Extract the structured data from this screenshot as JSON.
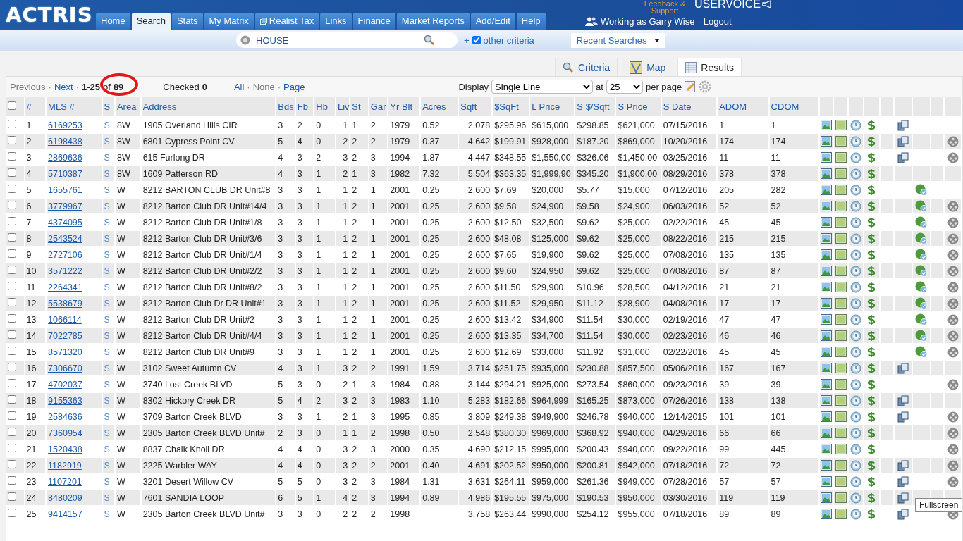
{
  "header": {
    "logo": "ACTRIS",
    "nav": [
      {
        "label": "Home",
        "selected": false
      },
      {
        "label": "Search",
        "selected": true
      },
      {
        "label": "Stats",
        "selected": false
      },
      {
        "label": "My Matrix",
        "selected": false
      },
      {
        "label": "Realist Tax",
        "selected": false
      },
      {
        "label": "Links",
        "selected": false
      },
      {
        "label": "Finance",
        "selected": false
      },
      {
        "label": "Market Reports",
        "selected": false
      },
      {
        "label": "Add/Edit",
        "selected": false
      },
      {
        "label": "Help",
        "selected": false
      }
    ],
    "feedback": "Feedback & Support",
    "uservoice": "USERVOICE",
    "user": "Working as Garry Wise",
    "separator": "·",
    "logout": "Logout"
  },
  "search_bar": {
    "query": "HOUSE",
    "plus": "+",
    "other_criteria": {
      "label": "other criteria",
      "checked": true
    },
    "recent": "Recent Searches"
  },
  "view_tabs": [
    {
      "label": "Criteria",
      "selected": false
    },
    {
      "label": "Map",
      "selected": false
    },
    {
      "label": "Results",
      "selected": true
    }
  ],
  "pager": {
    "separators": [
      "·",
      "·",
      "·",
      "·"
    ],
    "previous": {
      "label": "Previous",
      "disabled": true
    },
    "next": "Next",
    "range": "1-25",
    "of": "of",
    "total": "89",
    "checked_label": "Checked",
    "checked_count": "0",
    "all": "All",
    "none": {
      "label": "None",
      "disabled": true
    },
    "page": "Page",
    "display_label": "Display",
    "display_value": "Single Line",
    "at": "at",
    "per_page_value": "25",
    "per_page": "per page"
  },
  "table": {
    "select_all_checked": false,
    "columns": [
      "#",
      "MLS #",
      "S",
      "Area",
      "Address",
      "Bds",
      "Fb",
      "Hb",
      "Liv",
      "St",
      "Gar",
      "Yr Blt",
      "Acres",
      "Sqft",
      "$SqFt",
      "L Price",
      "S $/Sqft",
      "S Price",
      "S Date",
      "ADOM",
      "CDOM"
    ],
    "rows": [
      {
        "checked": false,
        "flyer": true,
        "price_change": false,
        "reel": false,
        "cells": [
          "1",
          "6169253",
          "S",
          "8W",
          "1905 Overland Hills CIR",
          "3",
          "2",
          "0",
          "1",
          "1",
          "2",
          "1979",
          "0.52",
          "2,078",
          "$295.96",
          "$615,000",
          "$298.85",
          "$621,000",
          "07/15/2016",
          "1",
          "1"
        ]
      },
      {
        "checked": false,
        "flyer": true,
        "price_change": false,
        "reel": true,
        "cells": [
          "2",
          "6198438",
          "S",
          "8W",
          "6801 Cypress Point CV",
          "5",
          "4",
          "0",
          "2",
          "2",
          "2",
          "1979",
          "0.37",
          "4,642",
          "$199.91",
          "$928,000",
          "$187.20",
          "$869,000",
          "10/20/2016",
          "174",
          "174"
        ]
      },
      {
        "checked": false,
        "flyer": true,
        "price_change": false,
        "reel": true,
        "cells": [
          "3",
          "2869636",
          "S",
          "8W",
          "615 Furlong DR",
          "4",
          "3",
          "2",
          "3",
          "2",
          "3",
          "1994",
          "1.87",
          "4,447",
          "$348.55",
          "$1,550,00",
          "$326.06",
          "$1,450,00",
          "03/25/2016",
          "11",
          "11"
        ]
      },
      {
        "checked": false,
        "flyer": false,
        "price_change": false,
        "reel": false,
        "cells": [
          "4",
          "5710387",
          "S",
          "8W",
          "1609 Patterson RD",
          "4",
          "3",
          "1",
          "2",
          "1",
          "3",
          "1982",
          "7.32",
          "5,504",
          "$363.35",
          "$1,999,90",
          "$345.20",
          "$1,900,00",
          "08/29/2016",
          "378",
          "378"
        ]
      },
      {
        "checked": false,
        "flyer": false,
        "price_change": true,
        "reel": false,
        "cells": [
          "5",
          "1655761",
          "S",
          "W",
          "8212 BARTON CLUB DR Unit#8",
          "3",
          "3",
          "1",
          "1",
          "2",
          "1",
          "2001",
          "0.25",
          "2,600",
          "$7.69",
          "$20,000",
          "$5.77",
          "$15,000",
          "07/12/2016",
          "205",
          "282"
        ]
      },
      {
        "checked": false,
        "flyer": false,
        "price_change": true,
        "reel": true,
        "cells": [
          "6",
          "3779967",
          "S",
          "W",
          "8212 Barton Club DR Unit#14/4",
          "3",
          "3",
          "1",
          "1",
          "2",
          "1",
          "2001",
          "0.25",
          "2,600",
          "$9.58",
          "$24,900",
          "$9.58",
          "$24,900",
          "06/03/2016",
          "52",
          "52"
        ]
      },
      {
        "checked": false,
        "flyer": false,
        "price_change": true,
        "reel": true,
        "cells": [
          "7",
          "4374095",
          "S",
          "W",
          "8212 Barton Club DR Unit#1/8",
          "3",
          "3",
          "1",
          "1",
          "2",
          "1",
          "2001",
          "0.25",
          "2,600",
          "$12.50",
          "$32,500",
          "$9.62",
          "$25,000",
          "02/22/2016",
          "45",
          "45"
        ]
      },
      {
        "checked": false,
        "flyer": false,
        "price_change": true,
        "reel": true,
        "cells": [
          "8",
          "2543524",
          "S",
          "W",
          "8212 Barton Club DR Unit#3/6",
          "3",
          "3",
          "1",
          "1",
          "2",
          "1",
          "2001",
          "0.25",
          "2,600",
          "$48.08",
          "$125,000",
          "$9.62",
          "$25,000",
          "08/22/2016",
          "215",
          "215"
        ]
      },
      {
        "checked": false,
        "flyer": false,
        "price_change": true,
        "reel": true,
        "cells": [
          "9",
          "2727106",
          "S",
          "W",
          "8212 Barton Club DR Unit#1/4",
          "3",
          "3",
          "1",
          "1",
          "2",
          "1",
          "2001",
          "0.25",
          "2,600",
          "$7.65",
          "$19,900",
          "$9.62",
          "$25,000",
          "07/08/2016",
          "135",
          "135"
        ]
      },
      {
        "checked": false,
        "flyer": false,
        "price_change": true,
        "reel": true,
        "cells": [
          "10",
          "3571222",
          "S",
          "W",
          "8212 Barton Club DR Unit#2/2",
          "3",
          "3",
          "1",
          "1",
          "2",
          "1",
          "2001",
          "0.25",
          "2,600",
          "$9.60",
          "$24,950",
          "$9.62",
          "$25,000",
          "07/08/2016",
          "87",
          "87"
        ]
      },
      {
        "checked": false,
        "flyer": false,
        "price_change": true,
        "reel": true,
        "cells": [
          "11",
          "2264341",
          "S",
          "W",
          "8212 Barton Club DR Unit#8/2",
          "3",
          "3",
          "1",
          "1",
          "2",
          "1",
          "2001",
          "0.25",
          "2,600",
          "$11.50",
          "$29,900",
          "$10.96",
          "$28,500",
          "04/12/2016",
          "21",
          "21"
        ]
      },
      {
        "checked": false,
        "flyer": false,
        "price_change": true,
        "reel": true,
        "cells": [
          "12",
          "5538679",
          "S",
          "W",
          "8212 Barton Club Dr DR Unit#1",
          "3",
          "3",
          "1",
          "1",
          "2",
          "1",
          "2001",
          "0.25",
          "2,600",
          "$11.52",
          "$29,950",
          "$11.12",
          "$28,900",
          "04/08/2016",
          "17",
          "17"
        ]
      },
      {
        "checked": false,
        "flyer": false,
        "price_change": true,
        "reel": true,
        "cells": [
          "13",
          "1066114",
          "S",
          "W",
          "8212 Barton Club DR Unit#2",
          "3",
          "3",
          "1",
          "1",
          "2",
          "1",
          "2001",
          "0.25",
          "2,600",
          "$13.42",
          "$34,900",
          "$11.54",
          "$30,000",
          "02/19/2016",
          "47",
          "47"
        ]
      },
      {
        "checked": false,
        "flyer": false,
        "price_change": true,
        "reel": true,
        "cells": [
          "14",
          "7022785",
          "S",
          "W",
          "8212 Barton Club DR Unit#4/4",
          "3",
          "3",
          "1",
          "1",
          "2",
          "1",
          "2001",
          "0.25",
          "2,600",
          "$13.35",
          "$34,700",
          "$11.54",
          "$30,000",
          "02/23/2016",
          "46",
          "46"
        ]
      },
      {
        "checked": false,
        "flyer": false,
        "price_change": true,
        "reel": true,
        "cells": [
          "15",
          "8571320",
          "S",
          "W",
          "8212 Barton Club DR Unit#9",
          "3",
          "3",
          "1",
          "1",
          "2",
          "1",
          "2001",
          "0.25",
          "2,600",
          "$12.69",
          "$33,000",
          "$11.92",
          "$31,000",
          "02/22/2016",
          "45",
          "45"
        ]
      },
      {
        "checked": false,
        "flyer": true,
        "price_change": false,
        "reel": false,
        "cells": [
          "16",
          "7306670",
          "S",
          "W",
          "3102 Sweet Autumn CV",
          "4",
          "3",
          "1",
          "3",
          "2",
          "2",
          "1991",
          "1.59",
          "3,714",
          "$251.75",
          "$935,000",
          "$230.88",
          "$857,500",
          "05/06/2016",
          "167",
          "167"
        ]
      },
      {
        "checked": false,
        "flyer": false,
        "price_change": false,
        "reel": true,
        "cells": [
          "17",
          "4702037",
          "S",
          "W",
          "3740 Lost Creek BLVD",
          "5",
          "3",
          "0",
          "2",
          "1",
          "3",
          "1984",
          "0.88",
          "3,144",
          "$294.21",
          "$925,000",
          "$273.54",
          "$860,000",
          "09/23/2016",
          "39",
          "39"
        ]
      },
      {
        "checked": false,
        "flyer": true,
        "price_change": false,
        "reel": false,
        "cells": [
          "18",
          "9155363",
          "S",
          "W",
          "8302 Hickory Creek DR",
          "5",
          "4",
          "2",
          "3",
          "2",
          "3",
          "1983",
          "1.10",
          "5,283",
          "$182.66",
          "$964,999",
          "$165.25",
          "$873,000",
          "07/26/2016",
          "138",
          "138"
        ]
      },
      {
        "checked": false,
        "flyer": true,
        "price_change": false,
        "reel": true,
        "cells": [
          "19",
          "2584636",
          "S",
          "W",
          "3709 Barton Creek BLVD",
          "3",
          "3",
          "1",
          "2",
          "1",
          "3",
          "1995",
          "0.85",
          "3,809",
          "$249.38",
          "$949,900",
          "$246.78",
          "$940,000",
          "12/14/2015",
          "101",
          "101"
        ]
      },
      {
        "checked": false,
        "flyer": false,
        "price_change": false,
        "reel": true,
        "cells": [
          "20",
          "7360954",
          "S",
          "W",
          "2305 Barton Creek BLVD Unit#",
          "2",
          "3",
          "0",
          "1",
          "1",
          "2",
          "1998",
          "0.50",
          "2,548",
          "$380.30",
          "$969,000",
          "$368.92",
          "$940,000",
          "04/29/2016",
          "66",
          "66"
        ]
      },
      {
        "checked": false,
        "flyer": false,
        "price_change": false,
        "reel": true,
        "cells": [
          "21",
          "1520438",
          "S",
          "W",
          "8837 Chalk Knoll DR",
          "4",
          "4",
          "0",
          "3",
          "2",
          "3",
          "2000",
          "0.35",
          "4,690",
          "$212.15",
          "$995,000",
          "$200.43",
          "$940,000",
          "09/22/2016",
          "99",
          "445"
        ]
      },
      {
        "checked": false,
        "flyer": true,
        "price_change": false,
        "reel": true,
        "cells": [
          "22",
          "1182919",
          "S",
          "W",
          "2225 Warbler WAY",
          "4",
          "4",
          "0",
          "3",
          "2",
          "2",
          "2001",
          "0.40",
          "4,691",
          "$202.52",
          "$950,000",
          "$200.81",
          "$942,000",
          "07/18/2016",
          "72",
          "72"
        ]
      },
      {
        "checked": false,
        "flyer": true,
        "price_change": false,
        "reel": true,
        "cells": [
          "23",
          "1107201",
          "S",
          "W",
          "3201 Desert Willow CV",
          "5",
          "5",
          "0",
          "3",
          "2",
          "3",
          "1984",
          "1.31",
          "3,631",
          "$264.11",
          "$959,000",
          "$261.36",
          "$949,000",
          "07/28/2016",
          "57",
          "57"
        ]
      },
      {
        "checked": false,
        "flyer": true,
        "price_change": false,
        "reel": false,
        "cells": [
          "24",
          "8480209",
          "S",
          "W",
          "7601 SANDIA LOOP",
          "6",
          "5",
          "1",
          "4",
          "2",
          "3",
          "1994",
          "0.89",
          "4,986",
          "$195.55",
          "$975,000",
          "$190.53",
          "$950,000",
          "03/30/2016",
          "119",
          "119"
        ]
      },
      {
        "checked": false,
        "flyer": true,
        "price_change": false,
        "reel": true,
        "cells": [
          "25",
          "9414157",
          "S",
          "W",
          "2305 Barton Creek BLVD Unit#",
          "3",
          "3",
          "0",
          "2",
          "2",
          "2",
          "1998",
          null,
          "3,758",
          "$263.44",
          "$990,000",
          "$254.12",
          "$955,000",
          "07/18/2016",
          "89",
          "89"
        ]
      }
    ]
  },
  "tooltip": "Fullscreen"
}
